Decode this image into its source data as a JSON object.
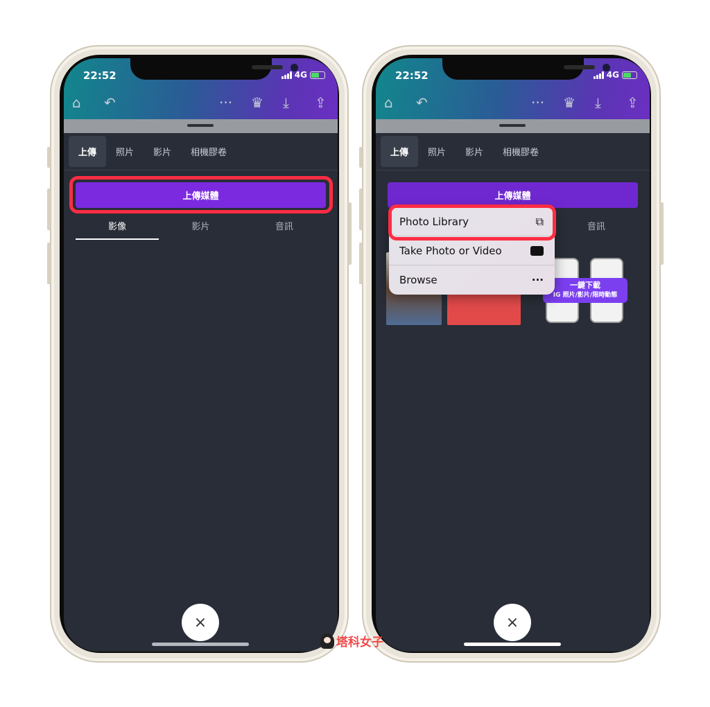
{
  "status": {
    "time": "22:52",
    "network": "4G"
  },
  "toolbar": {
    "icons": [
      "home-icon",
      "undo-icon",
      "more-icon",
      "crown-icon",
      "download-icon",
      "share-icon"
    ]
  },
  "tabs": [
    "上傳",
    "照片",
    "影片",
    "相機膠卷"
  ],
  "upload_button": "上傳媒體",
  "subtabs": [
    "影像",
    "影片",
    "音訊"
  ],
  "close_label": "×",
  "menu": {
    "items": [
      {
        "label": "Photo Library",
        "icon": "photo-library-icon"
      },
      {
        "label": "Take Photo or Video",
        "icon": "camera-icon"
      },
      {
        "label": "Browse",
        "icon": "more-icon"
      }
    ]
  },
  "promo": {
    "title": "一鍵下載",
    "subtitle": "IG 照片/影片/限時動態"
  },
  "watermark": "塔科女子",
  "colors": {
    "accent": "#7b2ae0",
    "highlight": "#ff2d44",
    "background": "#282d37"
  }
}
